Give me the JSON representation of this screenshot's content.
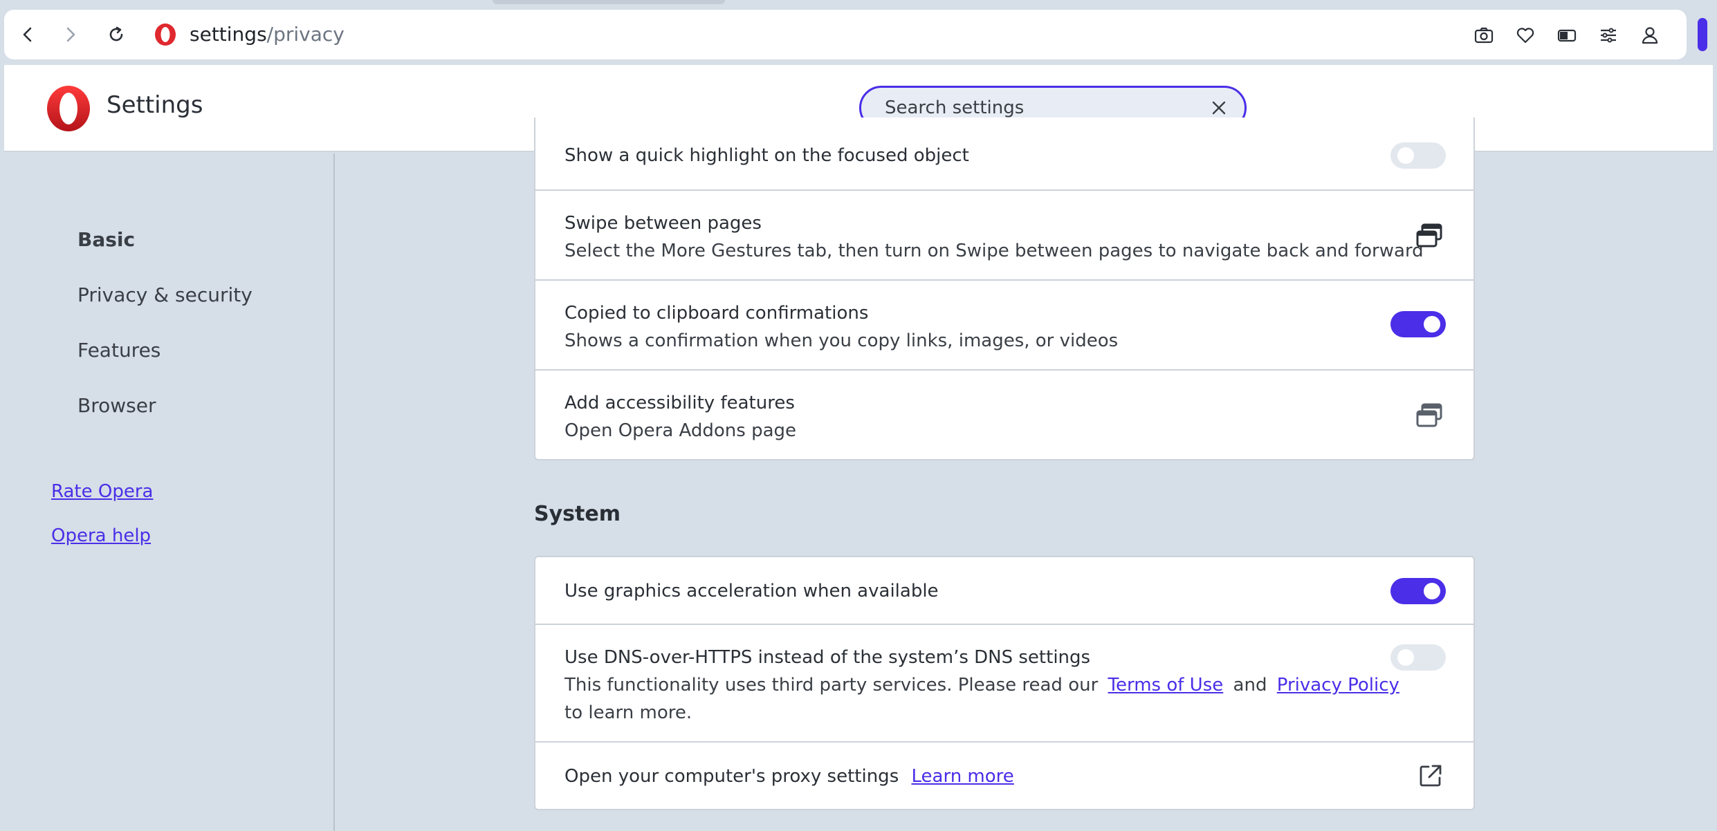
{
  "browser": {
    "url_host": "settings",
    "url_path": "/privacy"
  },
  "header": {
    "title": "Settings",
    "search_placeholder": "Search settings"
  },
  "sidebar": {
    "items": [
      {
        "label": "Basic",
        "active": true
      },
      {
        "label": "Privacy & security"
      },
      {
        "label": "Features"
      },
      {
        "label": "Browser"
      }
    ],
    "links": [
      {
        "label": "Rate Opera"
      },
      {
        "label": "Opera help"
      }
    ]
  },
  "accessibility_card": {
    "rows": [
      {
        "title": "Show a quick highlight on the focused object",
        "toggle": "off"
      },
      {
        "title": "Swipe between pages",
        "sub": "Select the More Gestures tab, then turn on Swipe between pages to navigate back and forward"
      },
      {
        "title": "Copied to clipboard confirmations",
        "sub": "Shows a confirmation when you copy links, images, or videos",
        "toggle": "on"
      },
      {
        "title": "Add accessibility features",
        "sub": "Open Opera Addons page"
      }
    ]
  },
  "system": {
    "title": "System",
    "rows": {
      "graphics": {
        "title": "Use graphics acceleration when available",
        "toggle": "on"
      },
      "dns": {
        "title": "Use DNS-over-HTTPS instead of the system’s DNS settings",
        "sub_before": "This functionality uses third party services. Please read our",
        "terms_link": "Terms of Use",
        "and": "and",
        "privacy_link": "Privacy Policy",
        "sub_after": "to learn more.",
        "toggle": "off"
      },
      "proxy": {
        "title": "Open your computer's proxy settings",
        "learn_more": "Learn more"
      }
    }
  },
  "colors": {
    "accent": "#4a2ee8",
    "page_bg": "#d6dee7",
    "opera_red": "#e0282f"
  }
}
